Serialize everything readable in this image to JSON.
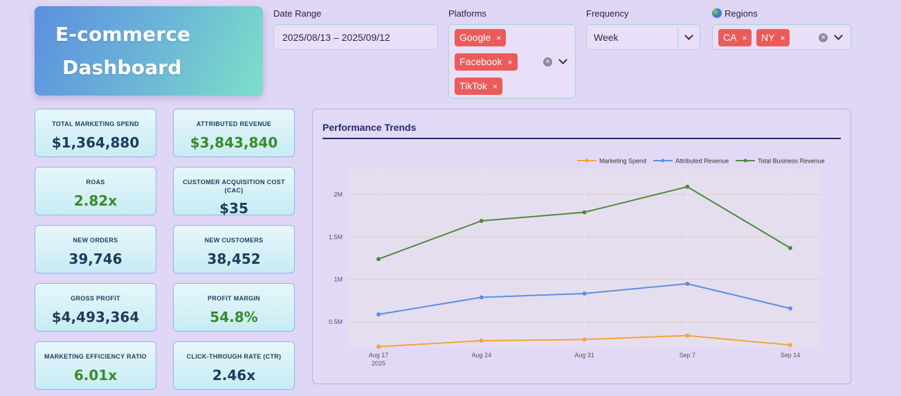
{
  "header": {
    "title_line1": "E-commerce",
    "title_line2": "Dashboard"
  },
  "filters": {
    "date_range": {
      "label": "Date Range",
      "value": "2025/08/13 – 2025/09/12"
    },
    "platforms": {
      "label": "Platforms",
      "selected": [
        "Google",
        "Facebook",
        "TikTok"
      ]
    },
    "frequency": {
      "label": "Frequency",
      "value": "Week"
    },
    "regions": {
      "label": "Regions",
      "selected": [
        "CA",
        "NY"
      ]
    },
    "remove_symbol": "×"
  },
  "kpis": [
    {
      "label": "TOTAL MARKETING SPEND",
      "value": "$1,364,880",
      "color": "#1f3a5e"
    },
    {
      "label": "ATTRIBUTED REVENUE",
      "value": "$3,843,840",
      "color": "#3a8a2a"
    },
    {
      "label": "ROAS",
      "value": "2.82x",
      "color": "#3a8a2a"
    },
    {
      "label": "CUSTOMER ACQUISITION COST (CAC)",
      "value": "$35",
      "color": "#1f3a5e"
    },
    {
      "label": "NEW ORDERS",
      "value": "39,746",
      "color": "#1f3a5e"
    },
    {
      "label": "NEW CUSTOMERS",
      "value": "38,452",
      "color": "#1f3a5e"
    },
    {
      "label": "GROSS PROFIT",
      "value": "$4,493,364",
      "color": "#1f3a5e"
    },
    {
      "label": "PROFIT MARGIN",
      "value": "54.8%",
      "color": "#3a8a2a"
    },
    {
      "label": "MARKETING EFFICIENCY RATIO",
      "value": "6.01x",
      "color": "#3a8a2a"
    },
    {
      "label": "CLICK-THROUGH RATE (CTR)",
      "value": "2.46x",
      "color": "#1f3a5e"
    }
  ],
  "chart": {
    "title": "Performance Trends"
  },
  "chart_data": {
    "type": "line",
    "x": [
      "Aug 17",
      "Aug 24",
      "Aug 31",
      "Sep 7",
      "Sep 14"
    ],
    "x_tick_labels": [
      "Aug 17",
      "Aug 24",
      "Aug 31",
      "Sep 7",
      "Sep 14"
    ],
    "x_year_label": "2025",
    "y_ticks": [
      500000,
      1000000,
      1500000,
      2000000
    ],
    "y_tick_labels": [
      "0.5M",
      "1M",
      "1.5M",
      "2M"
    ],
    "ylim": [
      200000,
      2300000
    ],
    "grid": true,
    "legend_position": "top-right",
    "series": [
      {
        "name": "Marketing Spend",
        "color": "#f2a33a",
        "values": [
          210000,
          280000,
          295000,
          340000,
          230000
        ]
      },
      {
        "name": "Attributed Revenue",
        "color": "#5b8fe0",
        "values": [
          590000,
          790000,
          835000,
          950000,
          660000
        ]
      },
      {
        "name": "Total Business Revenue",
        "color": "#4e8a3e",
        "values": [
          1240000,
          1690000,
          1790000,
          2090000,
          1370000
        ]
      }
    ]
  }
}
